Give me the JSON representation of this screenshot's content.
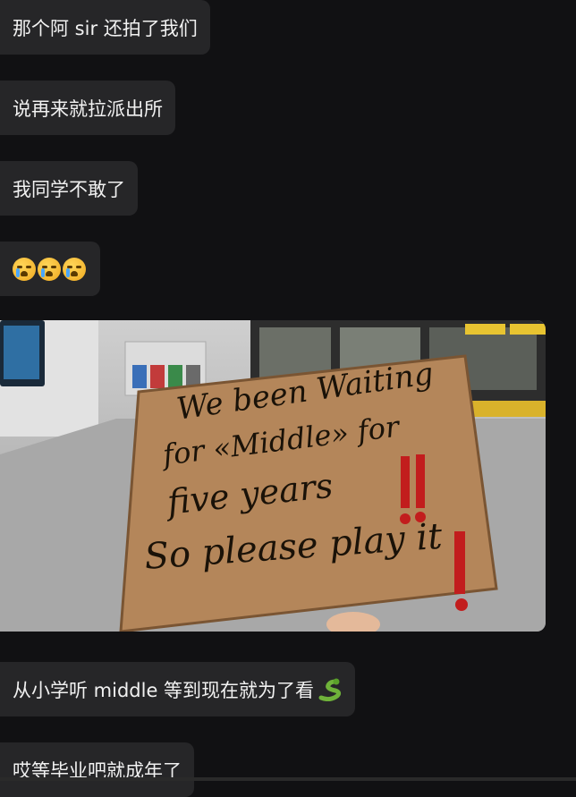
{
  "messages": [
    {
      "text": "那个阿 sir 还拍了我们"
    },
    {
      "text": "说再来就拉派出所"
    },
    {
      "text": "我同学不敢了"
    },
    {
      "emoji": "loudly-crying-face x3"
    },
    {
      "text": "从小学听 middle 等到现在就为了看"
    },
    {
      "text": "哎等毕业吧就成年了"
    }
  ],
  "photo": {
    "sign_lines": [
      "We been Waiting",
      "for «Middle» for",
      "five years",
      "So please play it"
    ],
    "exclamations": "!!"
  },
  "colors": {
    "background": "#111113",
    "bubble": "#262628",
    "text": "#f1f1f1",
    "sign_red": "#c21d1d"
  }
}
